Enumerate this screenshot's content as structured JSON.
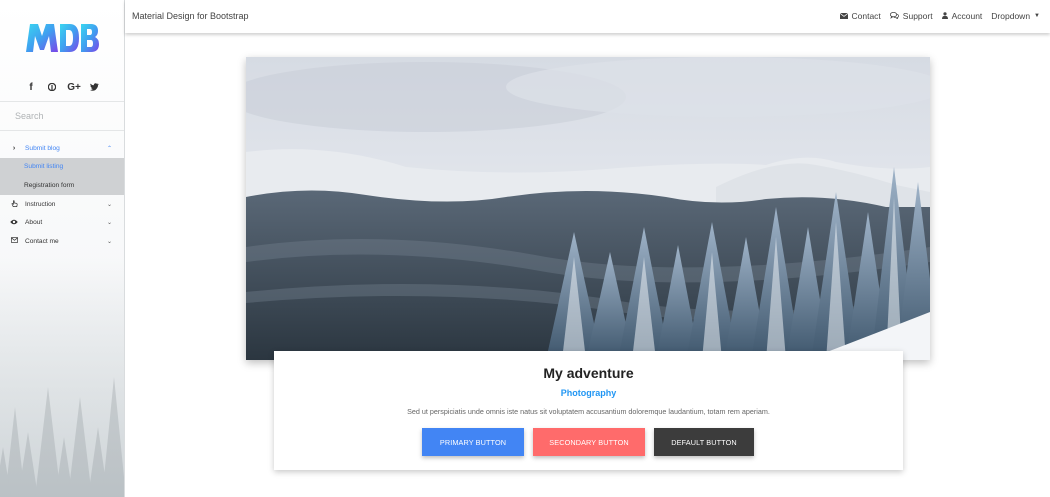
{
  "sidebar": {
    "logo_text": "MDB",
    "social": [
      "facebook-icon",
      "pinterest-icon",
      "google-plus-icon",
      "twitter-icon"
    ],
    "search_placeholder": "Search",
    "menu": [
      {
        "label": "Submit blog",
        "icon": "chevron-right-icon"
      },
      {
        "label": "Submit listing"
      },
      {
        "label": "Registration form"
      },
      {
        "label": "Instruction",
        "icon": "hand-pointer-icon"
      },
      {
        "label": "About",
        "icon": "eye-icon"
      },
      {
        "label": "Contact me",
        "icon": "envelope-icon"
      }
    ]
  },
  "navbar": {
    "brand": "Material Design for Bootstrap",
    "links": [
      "Contact",
      "Support",
      "Account",
      "Dropdown"
    ]
  },
  "card": {
    "title": "My adventure",
    "subtitle": "Photography",
    "text": "Sed ut perspiciatis unde omnis iste natus sit voluptatem accusantium doloremque laudantium, totam rem aperiam.",
    "buttons": [
      "PRIMARY BUTTON",
      "SECONDARY BUTTON",
      "DEFAULT BUTTON"
    ]
  },
  "colors": {
    "accent": "#4285f4",
    "secondary": "#ff6b6b",
    "default": "#3c3c3c",
    "subtitle": "#2196f3"
  }
}
